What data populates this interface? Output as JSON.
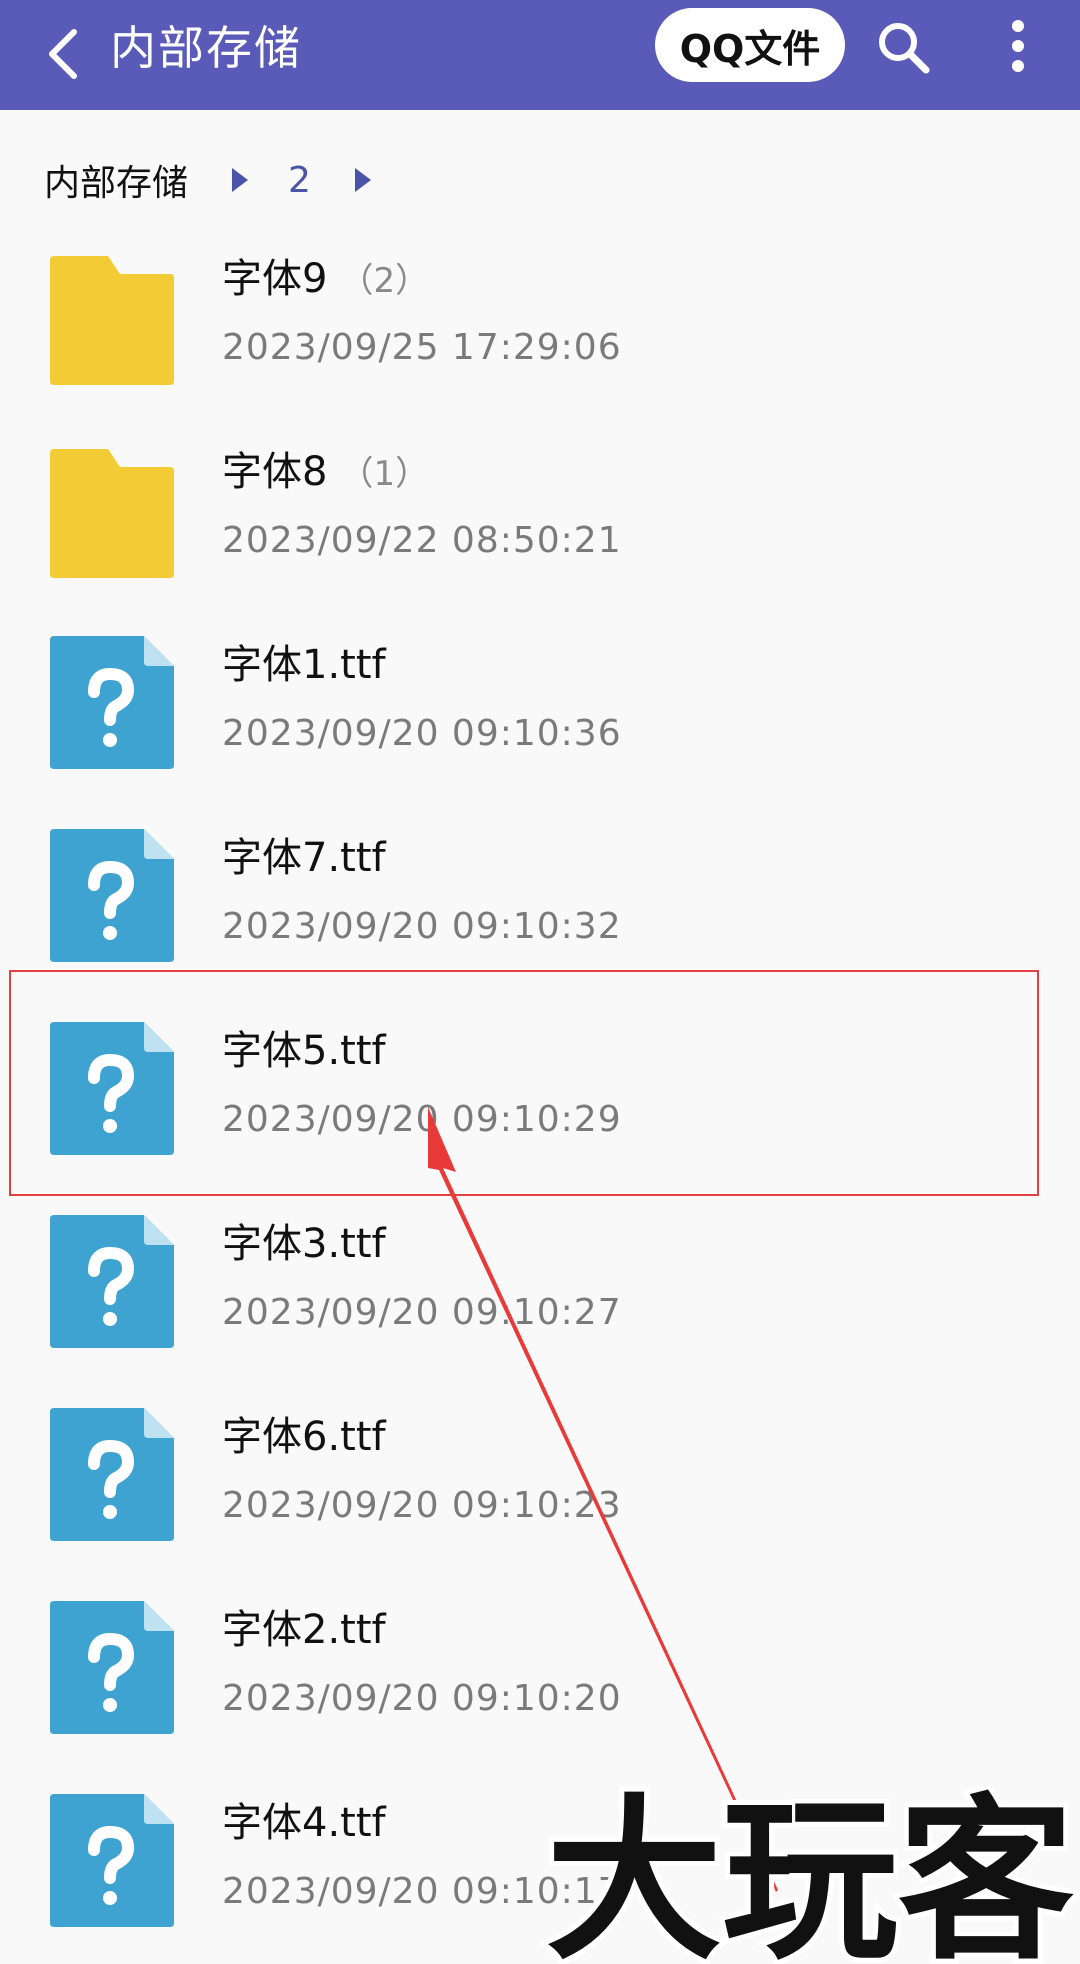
{
  "header": {
    "title": "内部存储",
    "qq_button_label": "QQ文件"
  },
  "breadcrumb": {
    "root": "内部存储",
    "current": "2"
  },
  "items": [
    {
      "type": "folder",
      "name": "字体9",
      "count": "（2）",
      "date": "2023/09/25 17:29:06"
    },
    {
      "type": "folder",
      "name": "字体8",
      "count": "（1）",
      "date": "2023/09/22 08:50:21"
    },
    {
      "type": "file",
      "name": "字体1.ttf",
      "count": "",
      "date": "2023/09/20 09:10:36"
    },
    {
      "type": "file",
      "name": "字体7.ttf",
      "count": "",
      "date": "2023/09/20 09:10:32"
    },
    {
      "type": "file",
      "name": "字体5.ttf",
      "count": "",
      "date": "2023/09/20 09:10:29"
    },
    {
      "type": "file",
      "name": "字体3.ttf",
      "count": "",
      "date": "2023/09/20 09:10:27"
    },
    {
      "type": "file",
      "name": "字体6.ttf",
      "count": "",
      "date": "2023/09/20 09:10:23"
    },
    {
      "type": "file",
      "name": "字体2.ttf",
      "count": "",
      "date": "2023/09/20 09:10:20"
    },
    {
      "type": "file",
      "name": "字体4.ttf",
      "count": "",
      "date": "2023/09/20 09:10:17"
    }
  ],
  "icons": {
    "back": "chevron-left-icon",
    "search": "search-icon",
    "more": "more-vertical-icon",
    "breadcrumb_arrow": "triangle-right-icon",
    "folder": "folder-icon",
    "unknown_file": "unknown-file-icon"
  },
  "colors": {
    "header": "#5a5bb8",
    "folder": "#f3cc35",
    "file": "#3fa3d1",
    "breadcrumb_accent": "#4a54a8",
    "annotation": "#e24040"
  },
  "watermark_text": "大玩客"
}
